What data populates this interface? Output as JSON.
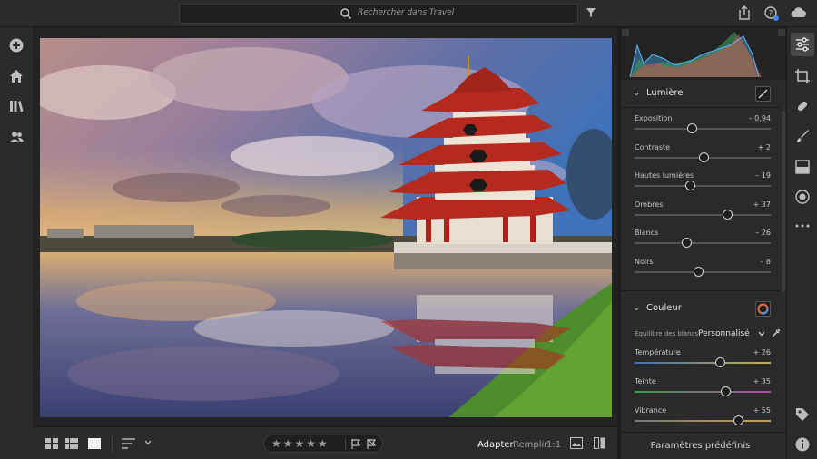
{
  "search": {
    "placeholder": "Rechercher dans Travel"
  },
  "left_toolbar": {
    "items": [
      {
        "icon": "add-icon"
      },
      {
        "icon": "home-icon"
      },
      {
        "icon": "library-icon"
      },
      {
        "icon": "people-icon"
      }
    ]
  },
  "bottom_bar": {
    "stars": "★★★★★",
    "zoom_adapter": "Adapter",
    "zoom_remplir": "Remplir",
    "zoom_one_to_one": "1:1"
  },
  "panel": {
    "lumiere": {
      "title": "Lumière",
      "sliders": [
        {
          "label": "Exposition",
          "value": "– 0,94",
          "position": 0.42
        },
        {
          "label": "Contraste",
          "value": "+ 2",
          "position": 0.51
        },
        {
          "label": "Hautes lumières",
          "value": "– 19",
          "position": 0.41
        },
        {
          "label": "Ombres",
          "value": "+ 37",
          "position": 0.68
        },
        {
          "label": "Blancs",
          "value": "– 26",
          "position": 0.38
        },
        {
          "label": "Noirs",
          "value": "– 8",
          "position": 0.47
        }
      ]
    },
    "couleur": {
      "title": "Couleur",
      "wb_label": "Équilibre des blancs",
      "wb_value": "Personnalisé",
      "sliders": [
        {
          "label": "Température",
          "value": "+ 26",
          "position": 0.63
        },
        {
          "label": "Teinte",
          "value": "+ 35",
          "position": 0.67
        },
        {
          "label": "Vibrance",
          "value": "+ 55",
          "position": 0.76
        }
      ]
    },
    "presets_label": "Paramètres prédéfinis"
  },
  "colors": {
    "accent": "#d4d4d4",
    "panel_bg": "#2a2a2a",
    "app_bg": "#1e1e1e"
  }
}
